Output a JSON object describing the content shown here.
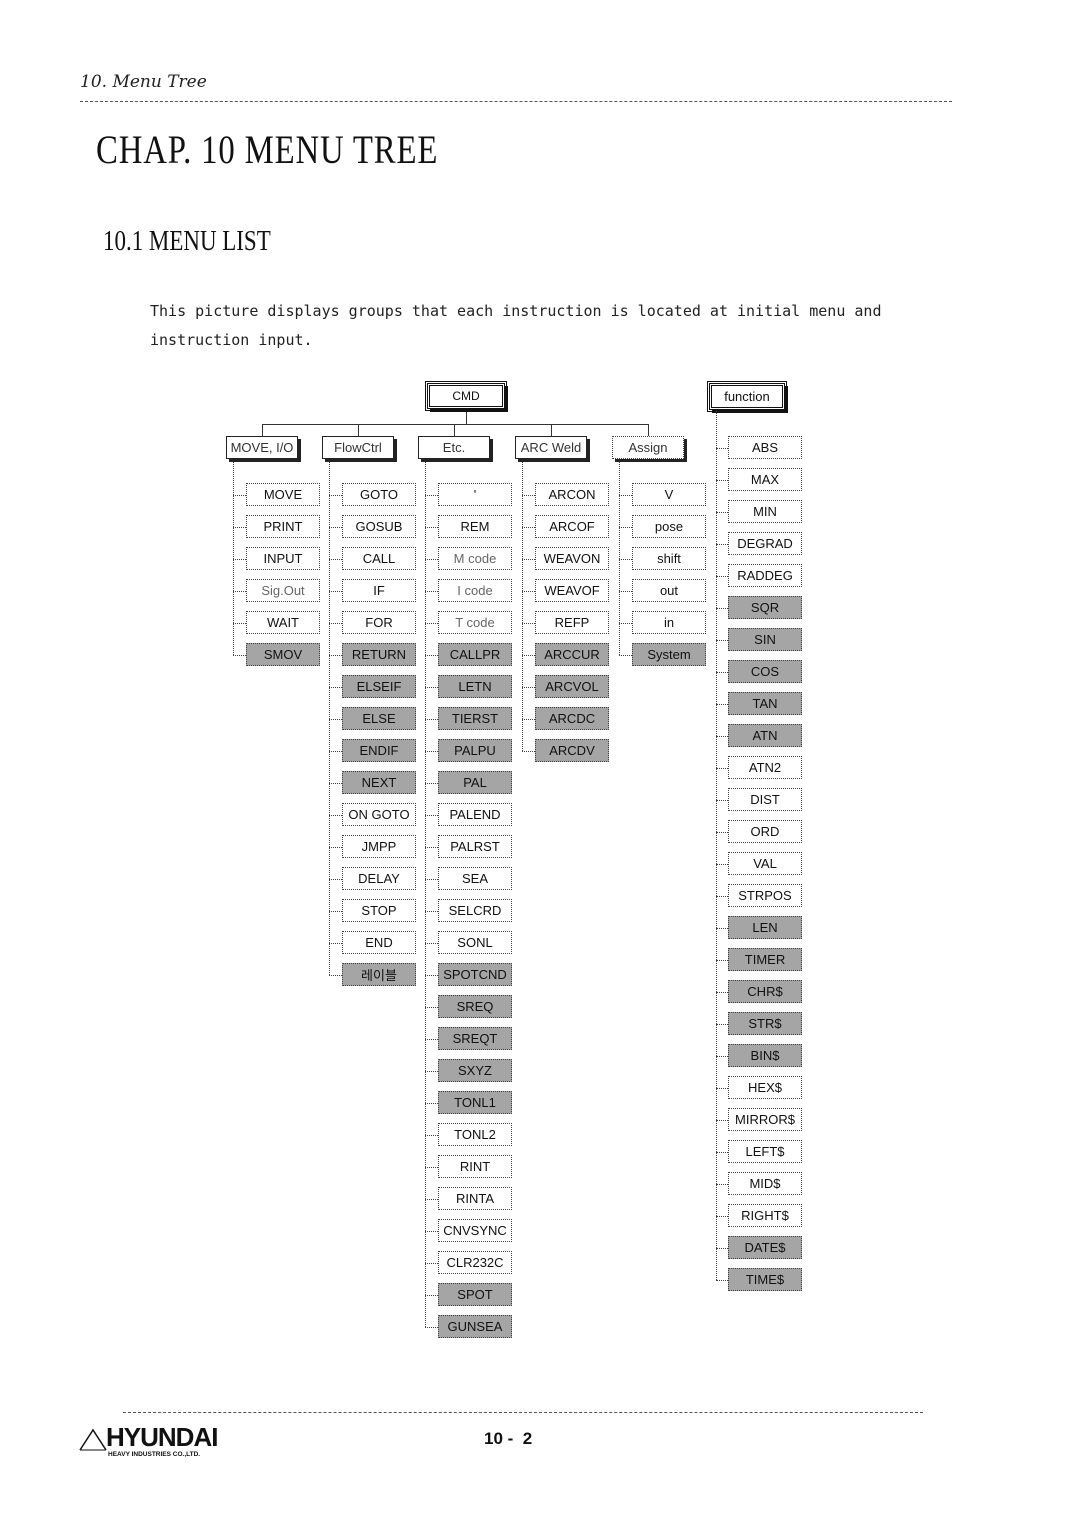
{
  "header": {
    "running_head": "10. Menu Tree",
    "chapter_title": "CHAP. 10 MENU TREE",
    "section_title": "10.1 MENU LIST",
    "paragraph": "This picture displays groups that each instruction is located at initial menu and instruction input."
  },
  "tree": {
    "root": "CMD",
    "function_root": "function",
    "categories": [
      {
        "label": "MOVE, I/O",
        "items": [
          {
            "label": "MOVE",
            "style": "normal"
          },
          {
            "label": "PRINT",
            "style": "normal"
          },
          {
            "label": "INPUT",
            "style": "normal"
          },
          {
            "label": "Sig.Out",
            "style": "light"
          },
          {
            "label": "WAIT",
            "style": "normal"
          },
          {
            "label": "SMOV",
            "style": "gray"
          }
        ]
      },
      {
        "label": "FlowCtrl",
        "items": [
          {
            "label": "GOTO",
            "style": "normal"
          },
          {
            "label": "GOSUB",
            "style": "normal"
          },
          {
            "label": "CALL",
            "style": "normal"
          },
          {
            "label": "IF",
            "style": "normal"
          },
          {
            "label": "FOR",
            "style": "normal"
          },
          {
            "label": "RETURN",
            "style": "gray"
          },
          {
            "label": "ELSEIF",
            "style": "gray"
          },
          {
            "label": "ELSE",
            "style": "gray"
          },
          {
            "label": "ENDIF",
            "style": "gray"
          },
          {
            "label": "NEXT",
            "style": "gray"
          },
          {
            "label": "ON GOTO",
            "style": "normal"
          },
          {
            "label": "JMPP",
            "style": "normal"
          },
          {
            "label": "DELAY",
            "style": "normal"
          },
          {
            "label": "STOP",
            "style": "normal"
          },
          {
            "label": "END",
            "style": "normal"
          },
          {
            "label": "레이블",
            "style": "gray"
          }
        ]
      },
      {
        "label": "Etc.",
        "items": [
          {
            "label": "'",
            "style": "normal"
          },
          {
            "label": "REM",
            "style": "normal"
          },
          {
            "label": "M code",
            "style": "light"
          },
          {
            "label": "I code",
            "style": "light"
          },
          {
            "label": "T code",
            "style": "light"
          },
          {
            "label": "CALLPR",
            "style": "gray"
          },
          {
            "label": "LETN",
            "style": "gray"
          },
          {
            "label": "TIERST",
            "style": "gray"
          },
          {
            "label": "PALPU",
            "style": "gray"
          },
          {
            "label": "PAL",
            "style": "gray"
          },
          {
            "label": "PALEND",
            "style": "normal"
          },
          {
            "label": "PALRST",
            "style": "normal"
          },
          {
            "label": "SEA",
            "style": "normal"
          },
          {
            "label": "SELCRD",
            "style": "normal"
          },
          {
            "label": "SONL",
            "style": "normal"
          },
          {
            "label": "SPOTCND",
            "style": "gray"
          },
          {
            "label": "SREQ",
            "style": "gray"
          },
          {
            "label": "SREQT",
            "style": "gray"
          },
          {
            "label": "SXYZ",
            "style": "gray"
          },
          {
            "label": "TONL1",
            "style": "gray"
          },
          {
            "label": "TONL2",
            "style": "normal"
          },
          {
            "label": "RINT",
            "style": "normal"
          },
          {
            "label": "RINTA",
            "style": "normal"
          },
          {
            "label": "CNVSYNC",
            "style": "normal"
          },
          {
            "label": "CLR232C",
            "style": "normal"
          },
          {
            "label": "SPOT",
            "style": "gray"
          },
          {
            "label": "GUNSEA",
            "style": "gray"
          }
        ]
      },
      {
        "label": "ARC Weld",
        "items": [
          {
            "label": "ARCON",
            "style": "normal"
          },
          {
            "label": "ARCOF",
            "style": "normal"
          },
          {
            "label": "WEAVON",
            "style": "normal"
          },
          {
            "label": "WEAVOF",
            "style": "normal"
          },
          {
            "label": "REFP",
            "style": "normal"
          },
          {
            "label": "ARCCUR",
            "style": "gray"
          },
          {
            "label": "ARCVOL",
            "style": "gray"
          },
          {
            "label": "ARCDC",
            "style": "gray"
          },
          {
            "label": "ARCDV",
            "style": "gray"
          }
        ]
      },
      {
        "label": "Assign",
        "items": [
          {
            "label": "V",
            "style": "normal"
          },
          {
            "label": "pose",
            "style": "normal"
          },
          {
            "label": "shift",
            "style": "normal"
          },
          {
            "label": "out",
            "style": "normal"
          },
          {
            "label": "in",
            "style": "normal"
          },
          {
            "label": "System",
            "style": "gray"
          }
        ]
      }
    ],
    "functions": [
      {
        "label": "ABS",
        "style": "normal"
      },
      {
        "label": "MAX",
        "style": "normal"
      },
      {
        "label": "MIN",
        "style": "normal"
      },
      {
        "label": "DEGRAD",
        "style": "normal"
      },
      {
        "label": "RADDEG",
        "style": "normal"
      },
      {
        "label": "SQR",
        "style": "gray"
      },
      {
        "label": "SIN",
        "style": "gray"
      },
      {
        "label": "COS",
        "style": "gray"
      },
      {
        "label": "TAN",
        "style": "gray"
      },
      {
        "label": "ATN",
        "style": "gray"
      },
      {
        "label": "ATN2",
        "style": "normal"
      },
      {
        "label": "DIST",
        "style": "normal"
      },
      {
        "label": "ORD",
        "style": "normal"
      },
      {
        "label": "VAL",
        "style": "normal"
      },
      {
        "label": "STRPOS",
        "style": "normal"
      },
      {
        "label": "LEN",
        "style": "gray"
      },
      {
        "label": "TIMER",
        "style": "gray"
      },
      {
        "label": "CHR$",
        "style": "gray"
      },
      {
        "label": "STR$",
        "style": "gray"
      },
      {
        "label": "BIN$",
        "style": "gray"
      },
      {
        "label": "HEX$",
        "style": "normal"
      },
      {
        "label": "MIRROR$",
        "style": "normal"
      },
      {
        "label": "LEFT$",
        "style": "normal"
      },
      {
        "label": "MID$",
        "style": "normal"
      },
      {
        "label": "RIGHT$",
        "style": "normal"
      },
      {
        "label": "DATE$",
        "style": "gray"
      },
      {
        "label": "TIME$",
        "style": "gray"
      }
    ]
  },
  "footer": {
    "logo_text": "HYUNDAI",
    "logo_subtext": "HEAVY INDUSTRIES CO.,LTD.",
    "page_number": "10 -  2"
  },
  "colors": {
    "gray_box": "#a5a5a5",
    "text": "#111111"
  }
}
